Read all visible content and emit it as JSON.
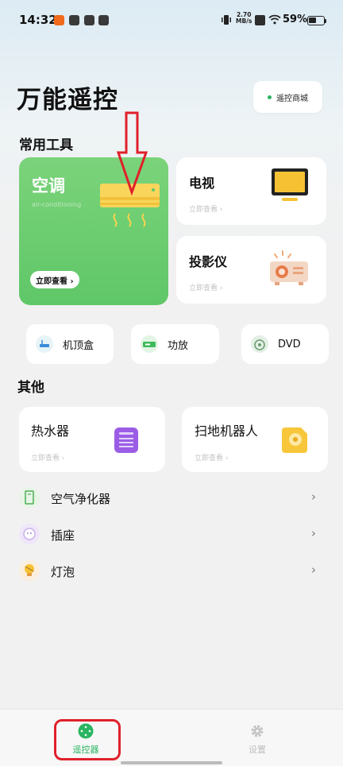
{
  "status_bar": {
    "time": "14:32",
    "net_speed_value": "2.70",
    "net_speed_unit": "MB/s",
    "battery": "59%"
  },
  "header": {
    "title": "万能遥控",
    "store_label": "遥控商城"
  },
  "common_tools": {
    "section_title": "常用工具",
    "air_conditioner": {
      "title": "空调",
      "subtitle": "air-conditioning",
      "button_label": "立即查看 ›"
    },
    "tv": {
      "title": "电视",
      "link": "立即查看 ›"
    },
    "projector": {
      "title": "投影仪",
      "link": "立即查看 ›"
    },
    "pills": [
      {
        "label": "机顶盒",
        "icon": "set-top-box-icon"
      },
      {
        "label": "功放",
        "icon": "amplifier-icon"
      },
      {
        "label": "DVD",
        "icon": "dvd-icon"
      }
    ]
  },
  "others": {
    "section_title": "其他",
    "water_heater": {
      "title": "热水器",
      "link": "立即查看 ›"
    },
    "robot_vacuum": {
      "title": "扫地机器人",
      "link": "立即查看 ›"
    },
    "list": [
      {
        "label": "空气净化器",
        "icon": "air-purifier-icon"
      },
      {
        "label": "插座",
        "icon": "socket-icon"
      },
      {
        "label": "灯泡",
        "icon": "light-bulb-icon"
      }
    ]
  },
  "tabbar": {
    "tabs": [
      {
        "label": "遥控器",
        "icon": "remote-icon",
        "active": true
      },
      {
        "label": "设置",
        "icon": "gear-icon",
        "active": false
      }
    ]
  },
  "colors": {
    "accent_green": "#2ab561",
    "ac_card": "#66c96c",
    "annotation_red": "#e0202a"
  }
}
